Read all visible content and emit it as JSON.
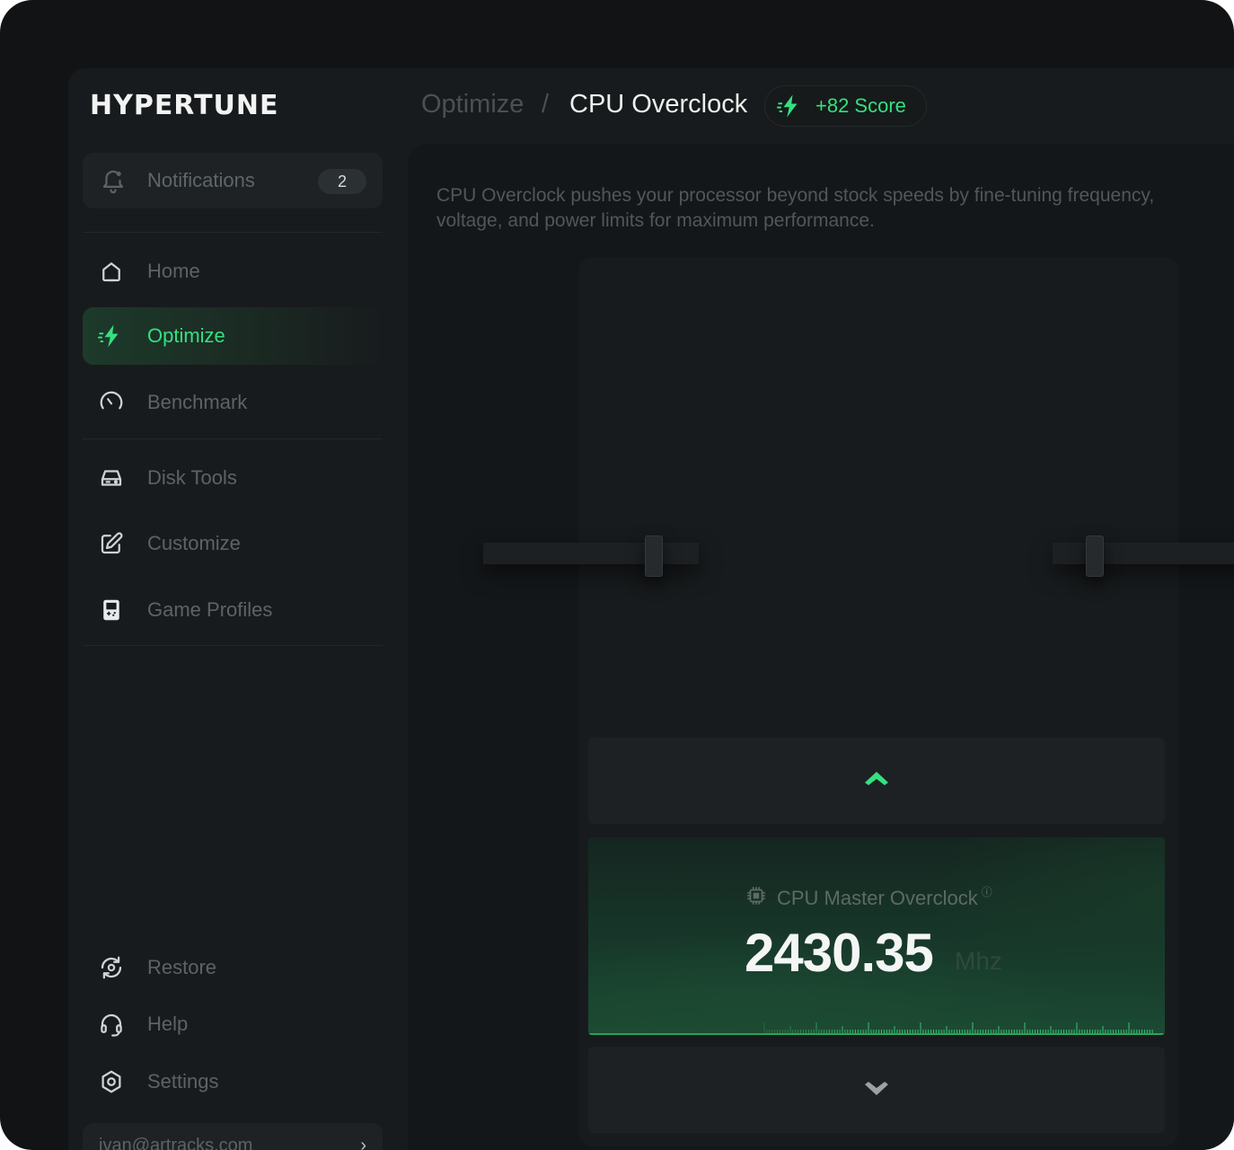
{
  "app": {
    "logo": "HYPERTUNE"
  },
  "sidebar": {
    "notifications": {
      "label": "Notifications",
      "count": "2",
      "icon": "bell-icon"
    },
    "items": [
      {
        "label": "Home",
        "icon": "home-icon",
        "active": false
      },
      {
        "label": "Optimize",
        "icon": "bolt-icon",
        "active": true
      },
      {
        "label": "Benchmark",
        "icon": "gauge-icon",
        "active": false
      },
      {
        "label": "Disk Tools",
        "icon": "disk-icon",
        "active": false
      },
      {
        "label": "Customize",
        "icon": "edit-icon",
        "active": false
      },
      {
        "label": "Game Profiles",
        "icon": "gamepad-icon",
        "active": false
      }
    ],
    "bottom_items": [
      {
        "label": "Restore",
        "icon": "restore-icon"
      },
      {
        "label": "Help",
        "icon": "headset-icon"
      },
      {
        "label": "Settings",
        "icon": "gear-icon"
      }
    ],
    "user": {
      "email": "ivan@artracks.com"
    }
  },
  "header": {
    "breadcrumb": {
      "parent": "Optimize",
      "separator": "/",
      "current": "CPU Overclock"
    },
    "score": {
      "label": "+82 Score",
      "icon": "bolt-icon"
    }
  },
  "main": {
    "description": "CPU Overclock pushes your processor beyond stock speeds by fine-tuning frequency, voltage, and power limits for maximum performance.",
    "readout": {
      "title": "CPU Master Overclock",
      "info_icon": "info-icon",
      "value": "2430.35",
      "unit": "Mhz",
      "icon": "chip-icon"
    },
    "controls": {
      "up_icon": "chevron-up-icon",
      "down_icon": "chevron-down-icon"
    }
  },
  "colors": {
    "accent": "#35e07f",
    "background": "#111315",
    "panel": "#181b1d"
  }
}
